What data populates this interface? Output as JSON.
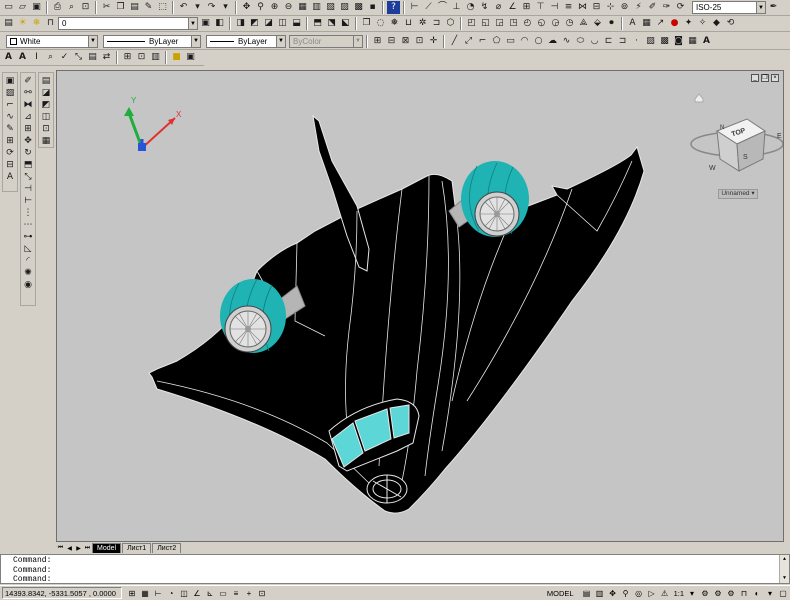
{
  "toolbar_row1": {
    "dimstyle": "ISO-25"
  },
  "toolbar_row2": {
    "layer": "0"
  },
  "toolbar_row3": {
    "color": "White",
    "linetype": "ByLayer",
    "lineweight": "ByLayer",
    "plotstyle": "ByColor"
  },
  "viewport": {
    "named_view": "Unnamed",
    "navcube_face": "TOP",
    "ucs_x": "X",
    "ucs_y": "Y",
    "compass": {
      "n": "N",
      "e": "E",
      "s": "S",
      "w": "W"
    },
    "colors": {
      "background": "#c5c5c5",
      "model": "#000000",
      "edges": "#e8e8e8",
      "engine": "#1fb3b3",
      "canopy": "#5cd6d6"
    }
  },
  "tabs": [
    {
      "label": "Model",
      "active": true
    },
    {
      "label": "Лист1",
      "active": false
    },
    {
      "label": "Лист2",
      "active": false
    }
  ],
  "command_history": [
    "Command:",
    "Command:",
    "Command:"
  ],
  "status": {
    "coordinates": "14393.8342, -5331.5057 , 0.0000",
    "model_label": "MODEL",
    "annotation_scale": "1:1"
  }
}
